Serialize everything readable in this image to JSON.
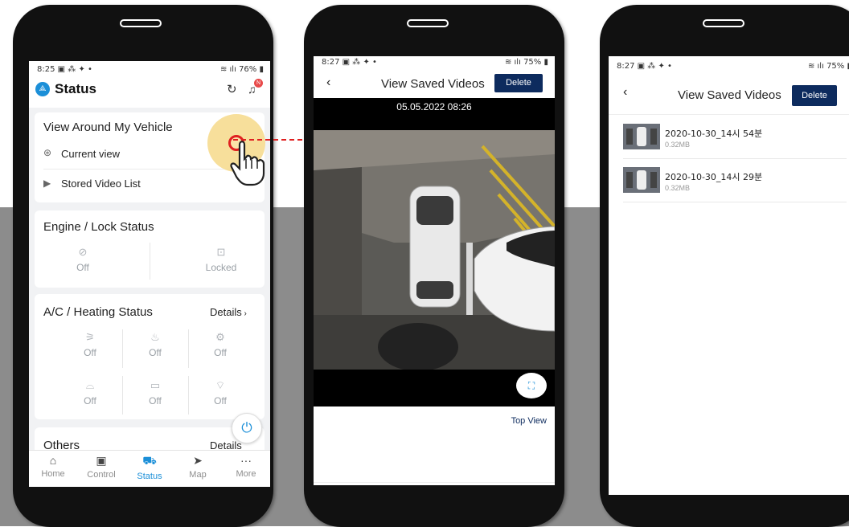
{
  "screen1": {
    "time": "8:25",
    "status_icons": "▣ ⁂ ✦ •",
    "battery": "76%",
    "title": "Status",
    "notification_badge": "N",
    "around": {
      "title": "View Around My Vehicle",
      "current_view": "Current view",
      "stored_list": "Stored Video List"
    },
    "engine": {
      "title": "Engine / Lock Status",
      "engine_value": "Off",
      "lock_value": "Locked"
    },
    "ac": {
      "title": "A/C / Heating Status",
      "details": "Details",
      "cells": [
        "Off",
        "Off",
        "Off",
        "Off",
        "Off",
        "Off"
      ]
    },
    "others": {
      "title": "Others",
      "details": "Details"
    },
    "nav": [
      "Home",
      "Control",
      "Status",
      "Map",
      "More"
    ]
  },
  "screen2": {
    "time": "8:27",
    "status_icons": "▣ ⁂ ✦ •",
    "battery": "75%",
    "title": "View Saved Videos",
    "delete": "Delete",
    "timestamp": "05.05.2022 08:26",
    "view_label": "Top View"
  },
  "screen3": {
    "time": "8:27",
    "status_icons": "▣ ⁂ ✦ •",
    "battery": "75%",
    "title": "View Saved Videos",
    "delete": "Delete",
    "videos": [
      {
        "name": "2020-10-30_14시 54분",
        "size": "0.32MB"
      },
      {
        "name": "2020-10-30_14시 29분",
        "size": "0.32MB"
      }
    ]
  },
  "colors": {
    "accent": "#1b8fd8",
    "navy": "#0d2b5e",
    "highlight": "#f6d98a",
    "pointer_red": "#e02020"
  }
}
